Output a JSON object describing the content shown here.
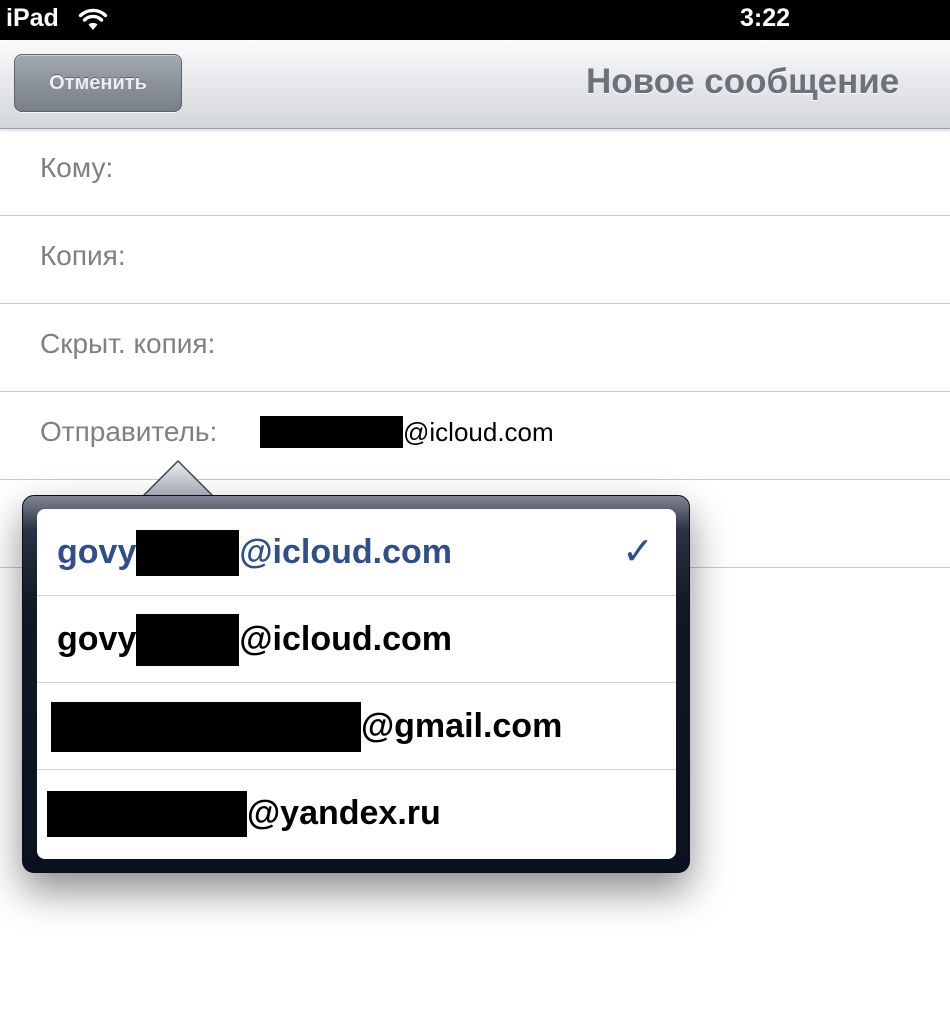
{
  "status_bar": {
    "carrier": "iPad",
    "wifi_icon": "wifi-icon",
    "time": "3:22"
  },
  "nav_bar": {
    "cancel_label": "Отменить",
    "title": "Новое сообщение"
  },
  "form": {
    "to_label": "Кому:",
    "cc_label": "Копия:",
    "bcc_label": "Скрыт. копия:",
    "from_label": "Отправитель:",
    "from_domain": "@icloud.com"
  },
  "account_picker": {
    "accounts": [
      {
        "prefix": "govy",
        "domain": "@icloud.com",
        "selected": true
      },
      {
        "prefix": "govy",
        "domain": "@icloud.com",
        "selected": false
      },
      {
        "prefix": "",
        "domain": "@gmail.com",
        "selected": false
      },
      {
        "prefix": "",
        "domain": "@yandex.ru",
        "selected": false
      }
    ],
    "checkmark": "✓"
  },
  "colors": {
    "selected_text": "#324f85",
    "label_gray": "#808080",
    "title_gray": "#6c717a"
  }
}
